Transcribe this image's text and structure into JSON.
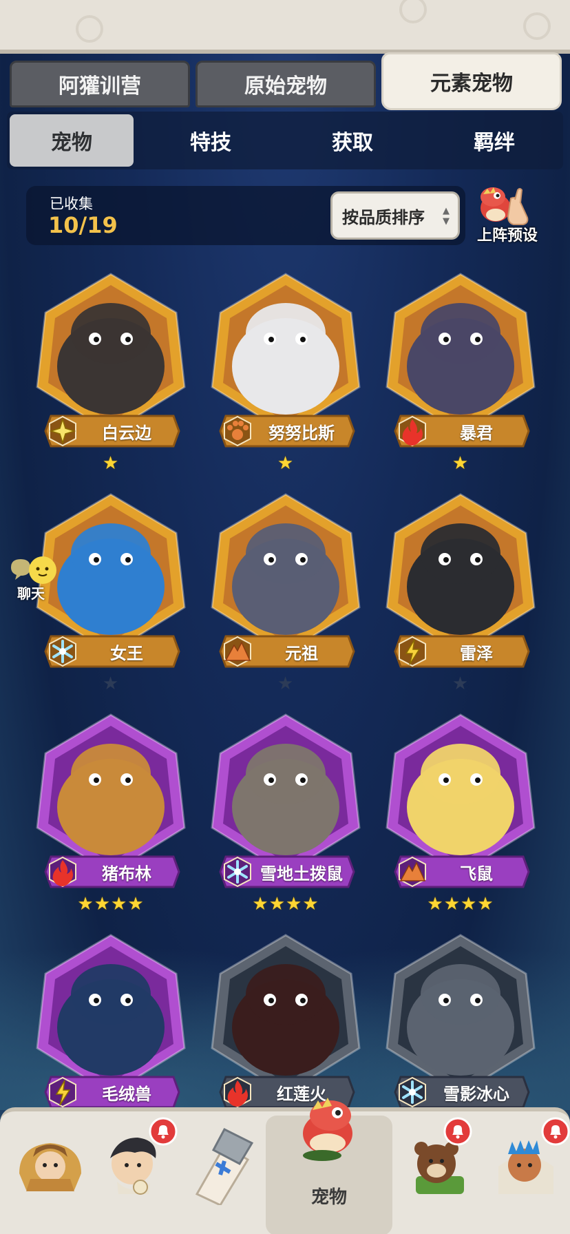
{
  "main_tabs": [
    {
      "label": "阿獾训营",
      "active": false
    },
    {
      "label": "原始宠物",
      "active": false
    },
    {
      "label": "元素宠物",
      "active": true
    }
  ],
  "sub_tabs": [
    {
      "label": "宠物",
      "active": true
    },
    {
      "label": "特技",
      "active": false
    },
    {
      "label": "获取",
      "active": false
    },
    {
      "label": "羁绊",
      "active": false
    }
  ],
  "collection": {
    "label": "已收集",
    "value": "10/19"
  },
  "sort_button": {
    "label": "按品质排序",
    "up_icon": "triangle-up-icon",
    "down_icon": "triangle-down-icon"
  },
  "preset": {
    "label": "上阵预设",
    "icon": "dino-finger-icon"
  },
  "chat": {
    "label": "聊天",
    "icon": "chat-bubble-icon"
  },
  "pets": [
    {
      "name": "白云边",
      "element": "lightning-star-icon",
      "stars": 1,
      "max_stars": 1,
      "rarity": "gold",
      "accent": "#e3a12b"
    },
    {
      "name": "努努比斯",
      "element": "paw-icon",
      "stars": 1,
      "max_stars": 1,
      "rarity": "gold",
      "accent": "#e3a12b"
    },
    {
      "name": "暴君",
      "element": "fire-icon",
      "stars": 1,
      "max_stars": 1,
      "rarity": "gold",
      "accent": "#e3a12b"
    },
    {
      "name": "女王",
      "element": "snowflake-icon",
      "stars": 0,
      "max_stars": 1,
      "rarity": "gold",
      "accent": "#e3a12b"
    },
    {
      "name": "元祖",
      "element": "mountain-icon",
      "stars": 0,
      "max_stars": 1,
      "rarity": "gold",
      "accent": "#e3a12b"
    },
    {
      "name": "雷泽",
      "element": "lightning-icon",
      "stars": 0,
      "max_stars": 1,
      "rarity": "gold",
      "accent": "#e3a12b"
    },
    {
      "name": "猪布林",
      "element": "fire-icon",
      "stars": 4,
      "max_stars": 4,
      "rarity": "purple",
      "accent": "#b04fd0"
    },
    {
      "name": "雪地土拨鼠",
      "element": "snowflake-icon",
      "stars": 4,
      "max_stars": 4,
      "rarity": "purple",
      "accent": "#b04fd0"
    },
    {
      "name": "飞鼠",
      "element": "mountain-icon",
      "stars": 4,
      "max_stars": 4,
      "rarity": "purple",
      "accent": "#b04fd0"
    },
    {
      "name": "毛绒兽",
      "element": "lightning-icon",
      "stars": 0,
      "max_stars": 0,
      "rarity": "purple",
      "accent": "#b04fd0"
    },
    {
      "name": "红莲火",
      "element": "fire-icon",
      "stars": 0,
      "max_stars": 0,
      "rarity": "locked",
      "accent": "#6a6f74"
    },
    {
      "name": "雪影冰心",
      "element": "snowflake-icon",
      "stars": 0,
      "max_stars": 0,
      "rarity": "locked",
      "accent": "#6a6f74"
    }
  ],
  "bottom_nav": [
    {
      "name": "caveman-icon",
      "label": "",
      "bell": false
    },
    {
      "name": "hero-icon",
      "label": "",
      "bell": true
    },
    {
      "name": "weapon-icon",
      "label": "",
      "bell": false
    },
    {
      "name": "pet-dino-icon",
      "label": "宠物",
      "bell": false,
      "active": true
    },
    {
      "name": "bear-icon",
      "label": "",
      "bell": true
    },
    {
      "name": "chief-icon",
      "label": "",
      "bell": true
    }
  ],
  "colors": {
    "gold_frame": "#e3a12b",
    "purple_frame": "#b04fd0",
    "gold_plate": "#c8862a",
    "purple_plate": "#9a3fc0",
    "star": "#ffd633"
  }
}
